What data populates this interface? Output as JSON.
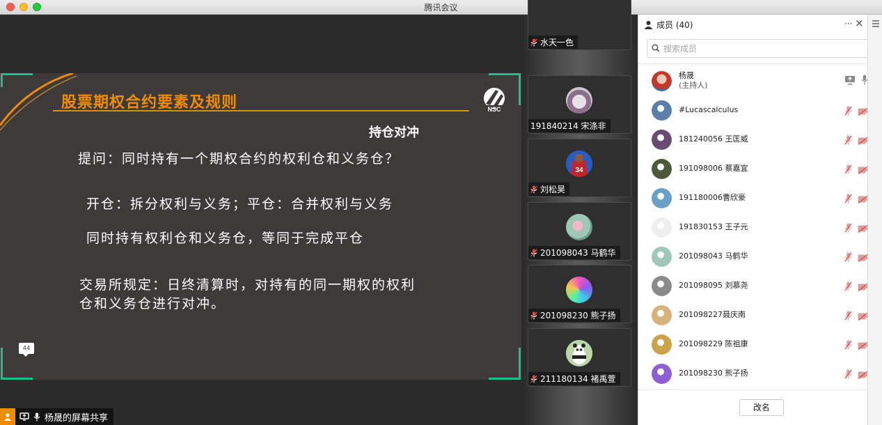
{
  "window": {
    "title": "腾讯会议"
  },
  "slide": {
    "title": "股票期权合约要素及规则",
    "logo_text": "NSC",
    "subtitle": "持仓对冲",
    "lines": [
      "提问：同时持有一个期权合约的权利仓和义务仓？",
      "开仓：拆分权利与义务；平仓：合并权利与义务",
      "同时持有权利仓和义务仓，等同于完成平仓",
      "交易所规定：日终清算时，对持有的同一期权的权利",
      "仓和义务仓进行对冲。"
    ],
    "page_number": "44"
  },
  "share_label": "杨晟的屏幕共享",
  "video_tiles": [
    {
      "name": "水天一色",
      "avatar": "none"
    },
    {
      "name": "191840214 宋涤非",
      "avatar": "photo-dish"
    },
    {
      "name": "刘松昊",
      "avatar": "jersey-34"
    },
    {
      "name": "201098043 马鹤华",
      "avatar": "flower"
    },
    {
      "name": "201098230 熊子扬",
      "avatar": "gradient-orb"
    },
    {
      "name": "211180134 褚禹萱",
      "avatar": "panda"
    }
  ],
  "panel": {
    "title": "成员 (40)",
    "more_label": "···",
    "close_label": "×",
    "search_placeholder": "搜索成员",
    "rename_label": "改名"
  },
  "members": [
    {
      "name": "杨晟",
      "role": "(主持人)",
      "avatar_color": "#c0392b",
      "mic": "on",
      "camera": "screen"
    },
    {
      "name": "#Lucascalculus",
      "role": "",
      "avatar_color": "#5b7fa6",
      "mic": "off",
      "camera": "off"
    },
    {
      "name": "181240056 王匡威",
      "role": "",
      "avatar_color": "#6b4a72",
      "mic": "off",
      "camera": "off"
    },
    {
      "name": "191098006 蔡嘉宜",
      "role": "",
      "avatar_color": "#4c5a3b",
      "mic": "off",
      "camera": "off"
    },
    {
      "name": "191180006曹欣豪",
      "role": "",
      "avatar_color": "#6aa0c8",
      "mic": "off",
      "camera": "off"
    },
    {
      "name": "191830153 王子元",
      "role": "",
      "avatar_color": "#eeeeee",
      "mic": "off",
      "camera": "off"
    },
    {
      "name": "201098043 马鹤华",
      "role": "",
      "avatar_color": "#9fc7b8",
      "mic": "off",
      "camera": "off"
    },
    {
      "name": "201098095 刘慕尧",
      "role": "",
      "avatar_color": "#8a8a8a",
      "mic": "off",
      "camera": "off"
    },
    {
      "name": "201098227聂庆南",
      "role": "",
      "avatar_color": "#d7b27a",
      "mic": "off",
      "camera": "off"
    },
    {
      "name": "201098229 陈祖康",
      "role": "",
      "avatar_color": "#c9a44a",
      "mic": "off",
      "camera": "off"
    },
    {
      "name": "201098230 熊子扬",
      "role": "",
      "avatar_color": "#8e5fd0",
      "mic": "off",
      "camera": "off"
    }
  ],
  "colors": {
    "accent_orange": "#f08c00",
    "frame_green": "#14c38e",
    "mic_off_red": "#e04a4a"
  }
}
